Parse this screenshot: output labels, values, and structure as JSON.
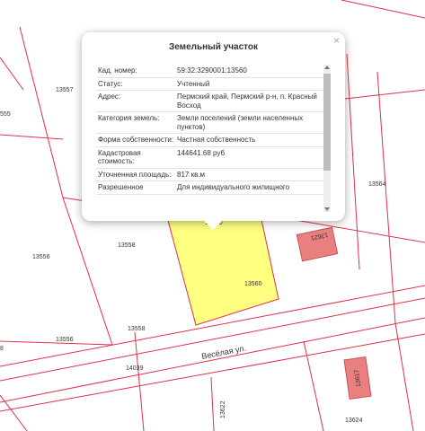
{
  "map": {
    "parcels": [
      "13557",
      "555",
      "13558",
      "13556",
      "13558",
      "13556",
      "13560",
      "13560",
      "13564",
      "13621",
      "14039",
      "13622",
      "13624",
      "8",
      "13617"
    ],
    "street": "Весёлая ул.",
    "colors": {
      "boundary": "#e0304a",
      "selected": "#ffff80",
      "building": "#ea7f7f"
    }
  },
  "popup": {
    "title": "Земельный участок",
    "close": "×",
    "rows": [
      {
        "key": "Кад. номер:",
        "value": "59:32:3290001:13560"
      },
      {
        "key": "Статус:",
        "value": "Учтенный"
      },
      {
        "key": "Адрес:",
        "value": "Пермский край, Пермский р-н, п. Красный Восход"
      },
      {
        "key": "Категория земель:",
        "value": "Земли поселений (земли населенных пунктов)"
      },
      {
        "key": "Форма собственности:",
        "value": "Частная собственность"
      },
      {
        "key": "Кадастровая стоимость:",
        "value": "144641.68 руб"
      },
      {
        "key": "Уточненная площадь:",
        "value": "817 кв.м"
      },
      {
        "key": "Разрешенное",
        "value": "Для индивидуального жилищного"
      }
    ]
  }
}
